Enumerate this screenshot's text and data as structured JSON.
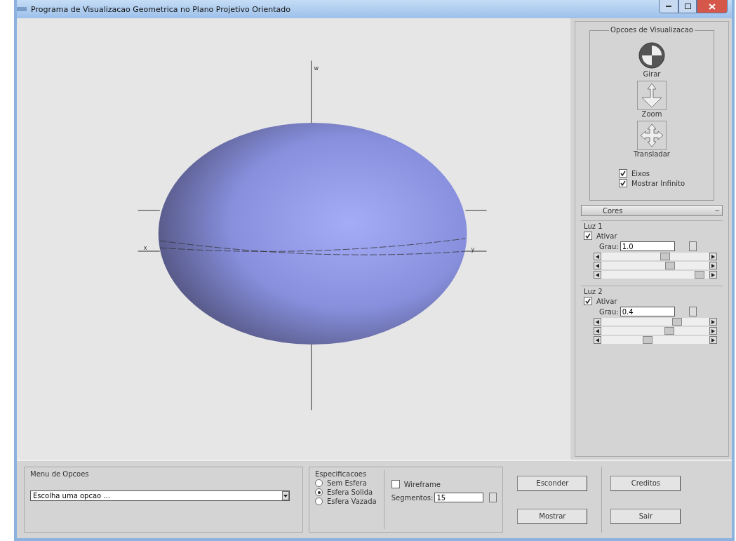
{
  "window": {
    "title": "Programa de Visualizacao Geometrica no Plano Projetivo Orientado"
  },
  "viewport": {
    "axes_visible": true,
    "axis_labels": [
      "w",
      "x",
      "y"
    ]
  },
  "view_options": {
    "title": "Opcoes de Visualizacao",
    "tools": [
      {
        "label": "Girar",
        "kind": "rotate"
      },
      {
        "label": "Zoom",
        "kind": "zoom"
      },
      {
        "label": "Transladar",
        "kind": "pan"
      }
    ],
    "checkboxes": [
      {
        "label": "Eixos",
        "checked": true
      },
      {
        "label": "Mostrar Infinito",
        "checked": true
      }
    ]
  },
  "colors": {
    "title": "Cores",
    "collapse_button": "–",
    "lights": [
      {
        "title": "Luz 1",
        "activate": {
          "label": "Ativar",
          "checked": true
        },
        "degree_label": "Grau:",
        "degree": "1.0",
        "sliders": [
          {
            "level": 0.6
          },
          {
            "level": 0.65
          },
          {
            "level": 0.95
          }
        ]
      },
      {
        "title": "Luz 2",
        "activate": {
          "label": "Ativar",
          "checked": true
        },
        "degree_label": "Grau:",
        "degree": "0.4",
        "sliders": [
          {
            "level": 0.72
          },
          {
            "level": 0.64
          },
          {
            "level": 0.42
          }
        ]
      }
    ]
  },
  "menu": {
    "title": "Menu de Opcoes",
    "select_value": "Escolha uma opcao ..."
  },
  "specs": {
    "title": "Especificacoes",
    "radios": [
      {
        "label": "Sem Esfera",
        "selected": false
      },
      {
        "label": "Esfera Solida",
        "selected": true
      },
      {
        "label": "Esfera Vazada",
        "selected": false
      }
    ],
    "wireframe": {
      "label": "Wireframe",
      "checked": false
    },
    "segments_label": "Segmentos:",
    "segments": "15"
  },
  "buttons": [
    [
      "Esconder",
      "Mostrar"
    ],
    [
      "Creditos",
      "Sair"
    ]
  ]
}
